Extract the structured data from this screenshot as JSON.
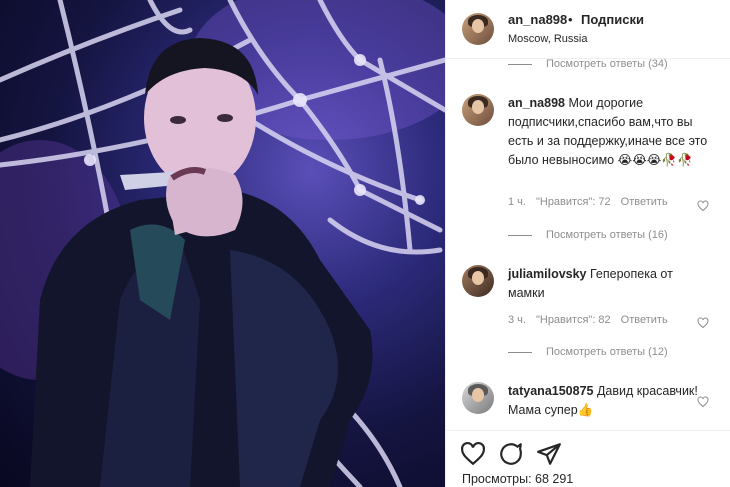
{
  "post": {
    "username": "an_na898",
    "separator": "•",
    "follow_label": "Подписки",
    "location": "Moscow, Russia"
  },
  "top_view_replies": "Посмотреть ответы (34)",
  "comments": [
    {
      "username": "an_na898",
      "text": "Мои дорогие подписчики,спасибо вам,что вы есть и за поддержку,иначе все это было невыносимо 😭😭😭🥀🥀",
      "time": "1 ч.",
      "likes": "\"Нравится\": 72",
      "reply": "Ответить",
      "view_replies": "Посмотреть ответы (16)"
    },
    {
      "username": "juliamilovsky",
      "text": "Геперопека от мамки",
      "time": "3 ч.",
      "likes": "\"Нравится\": 82",
      "reply": "Ответить",
      "view_replies": "Посмотреть ответы (12)"
    },
    {
      "username": "tatyana150875",
      "text": "Давид красавчик! Мама супер👍"
    }
  ],
  "footer": {
    "views": "Просмотры: 68 291"
  },
  "icons": {
    "like": "heart-icon",
    "comment": "comment-icon",
    "share": "share-icon"
  },
  "colors": {
    "meta_gray": "#8e8e8e",
    "text": "#262626",
    "border": "#efefef"
  }
}
